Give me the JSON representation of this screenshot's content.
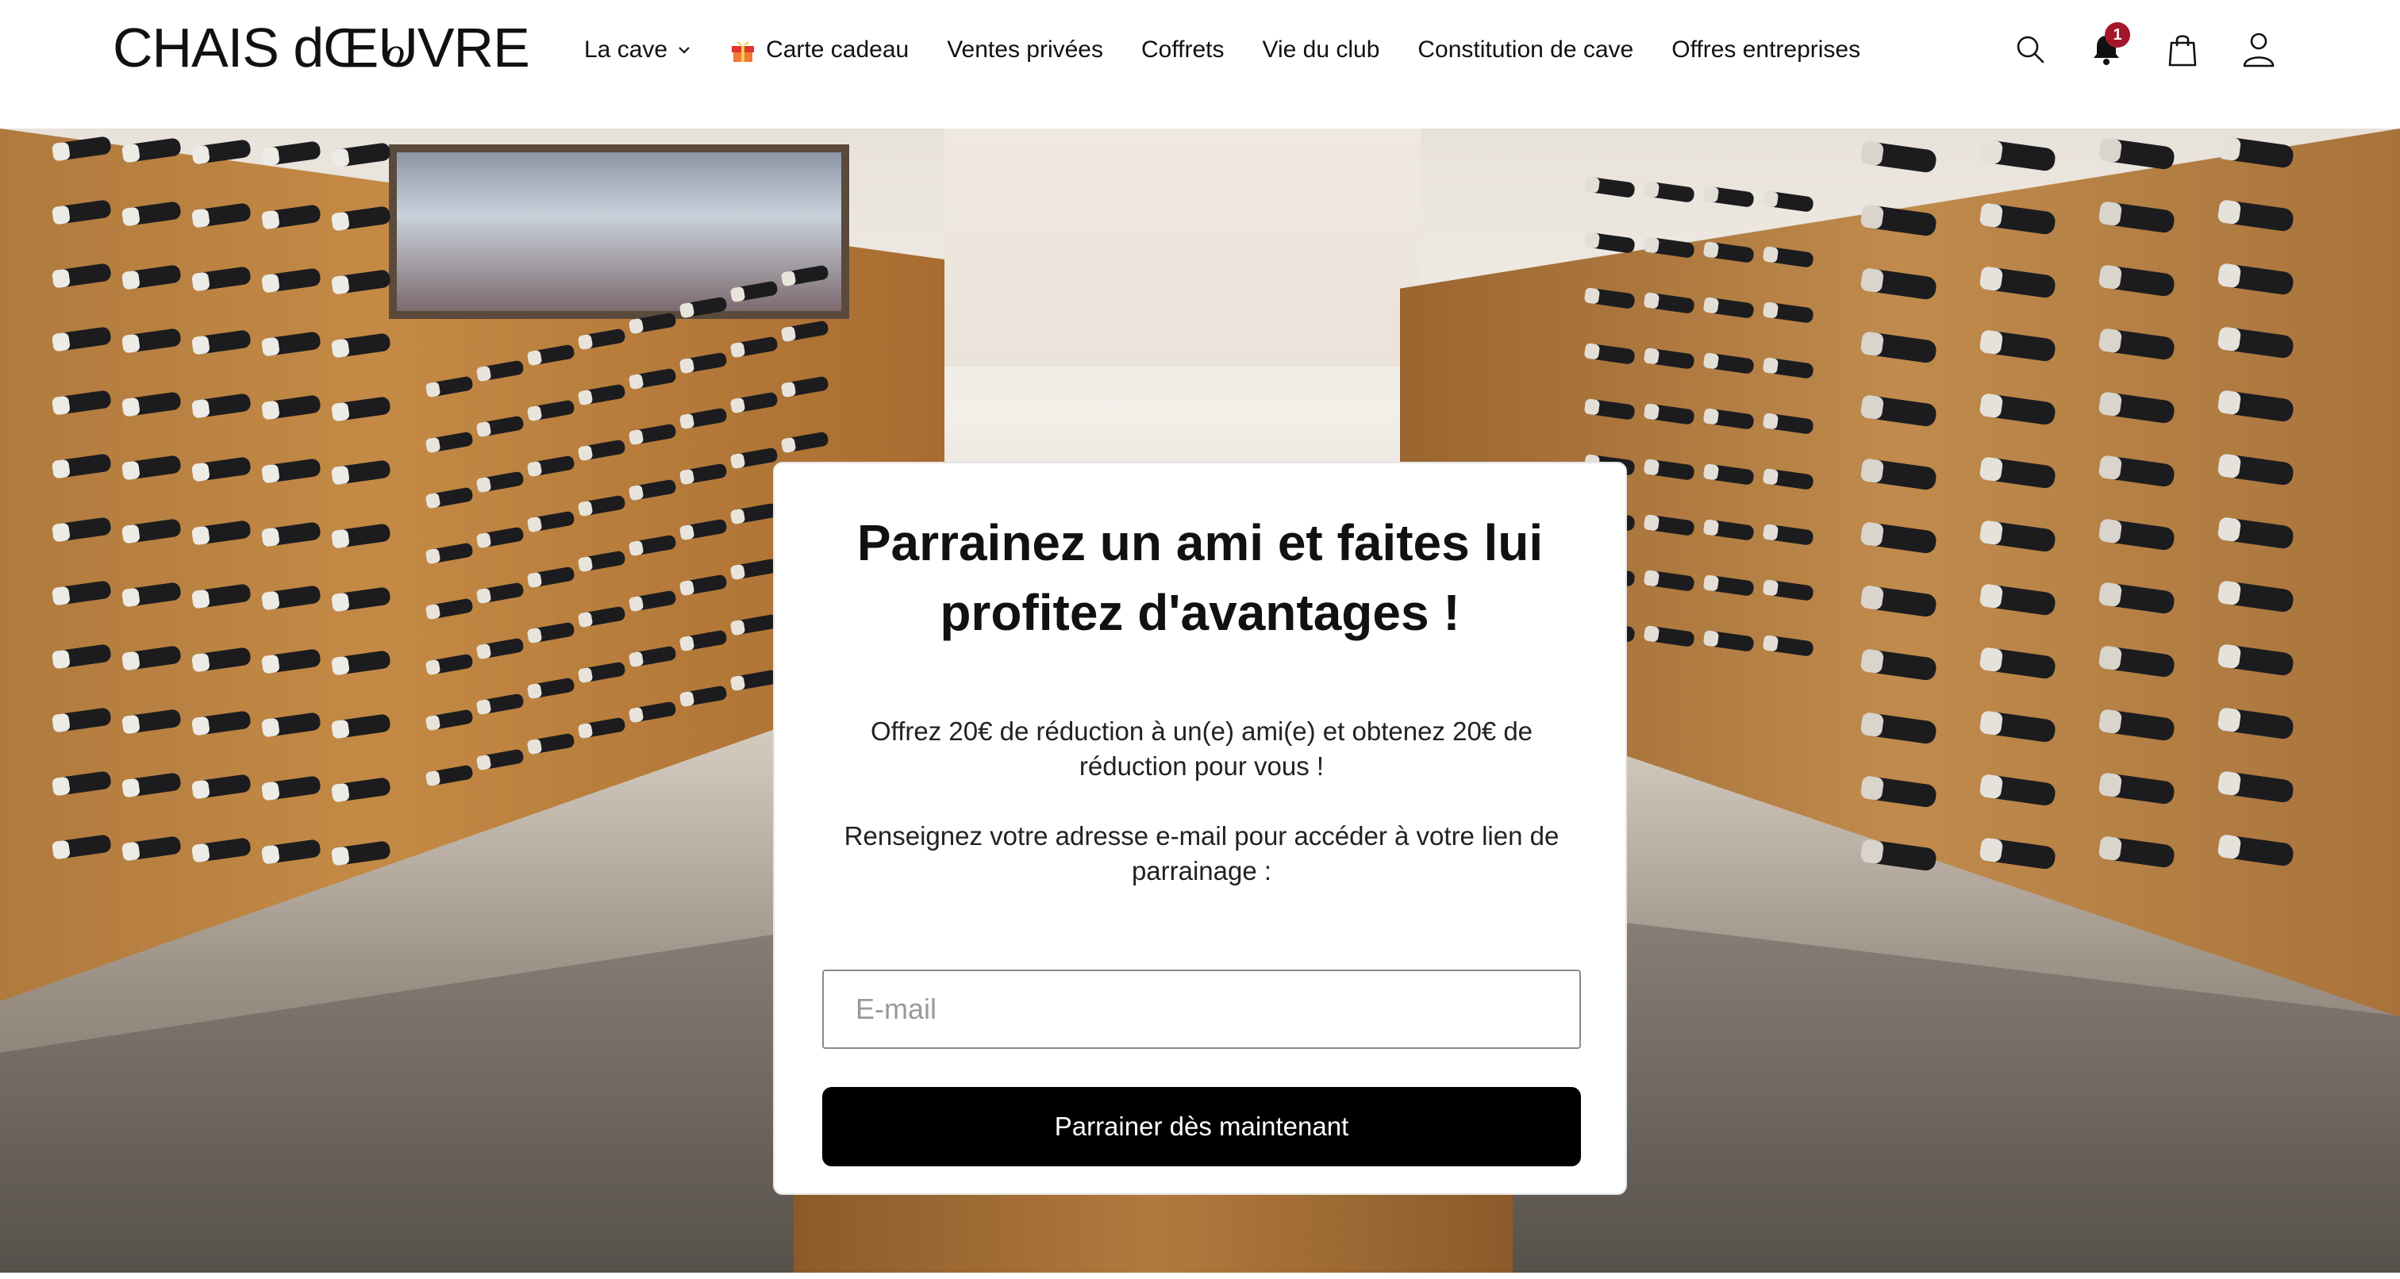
{
  "header": {
    "logo_text": "CHAIS d'ŒUVRE",
    "logo_main": "CHAIS d",
    "logo_flourish": "o",
    "logo_end": "ŒUVRE",
    "nav": [
      {
        "label": "La cave",
        "has_dropdown": true,
        "icon": "chevron-down-icon"
      },
      {
        "label": "Carte cadeau",
        "icon": "gift-icon"
      },
      {
        "label": "Ventes privées"
      },
      {
        "label": "Coffrets"
      },
      {
        "label": "Vie du club"
      },
      {
        "label": "Constitution de cave"
      },
      {
        "label": "Offres entreprises"
      }
    ],
    "icons": {
      "search": "search-icon",
      "notifications": "bell-icon",
      "notification_count": "1",
      "cart": "shopping-bag-icon",
      "account": "user-icon"
    }
  },
  "hero": {
    "image": "wine-cellar-photo"
  },
  "card": {
    "title": "Parrainez un ami et faites lui profitez d'avantages !",
    "text_offer": "Offrez 20€ de réduction à un(e) ami(e) et obtenez 20€ de réduction pour vous !",
    "text_instruction": "Renseignez votre adresse e-mail pour accéder à votre lien de parrainage :",
    "email_placeholder": "E-mail",
    "email_value": "",
    "cta_label": "Parrainer dès maintenant"
  },
  "colors": {
    "badge": "#a4162a",
    "cta_bg": "#000000",
    "cta_text": "#ffffff",
    "text": "#111111"
  }
}
